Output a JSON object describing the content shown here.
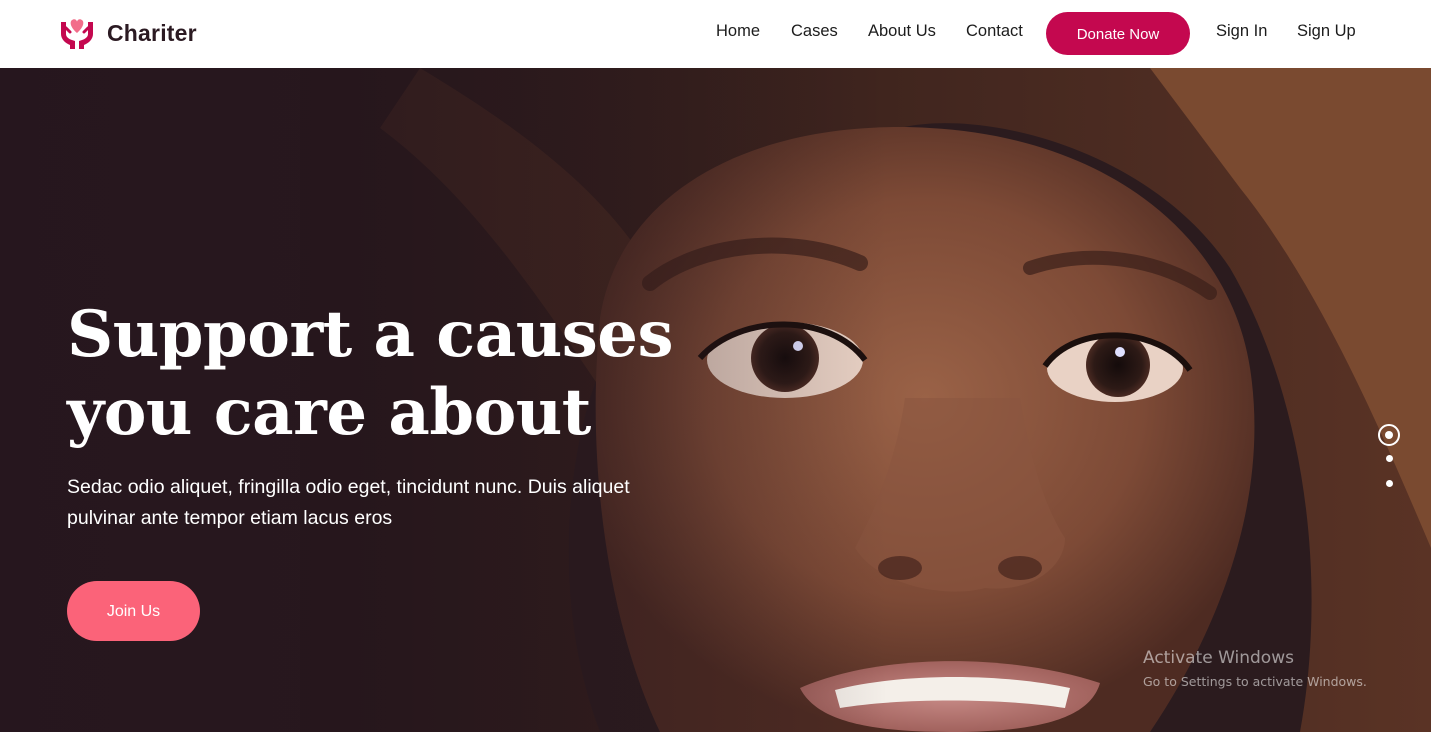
{
  "brand": {
    "name": "Chariter",
    "logo_icon": "hands-heart-icon",
    "color": "#c4084f"
  },
  "nav": {
    "items": [
      "Home",
      "Cases",
      "About Us",
      "Contact"
    ],
    "donate_label": "Donate Now",
    "sign_in": "Sign In",
    "sign_up": "Sign Up"
  },
  "hero": {
    "title": "Support a causes you care about",
    "subtitle": "Sedac odio aliquet, fringilla odio eget, tincidunt nunc. Duis aliquet pulvinar ante tempor etiam lacus eros",
    "cta_label": "Join Us",
    "cta_color": "#fb6379",
    "background_image": "child-face-photo",
    "slider": {
      "slides": 3,
      "active": 1
    }
  },
  "watermark": {
    "title": "Activate Windows",
    "subtitle": "Go to Settings to activate Windows."
  }
}
